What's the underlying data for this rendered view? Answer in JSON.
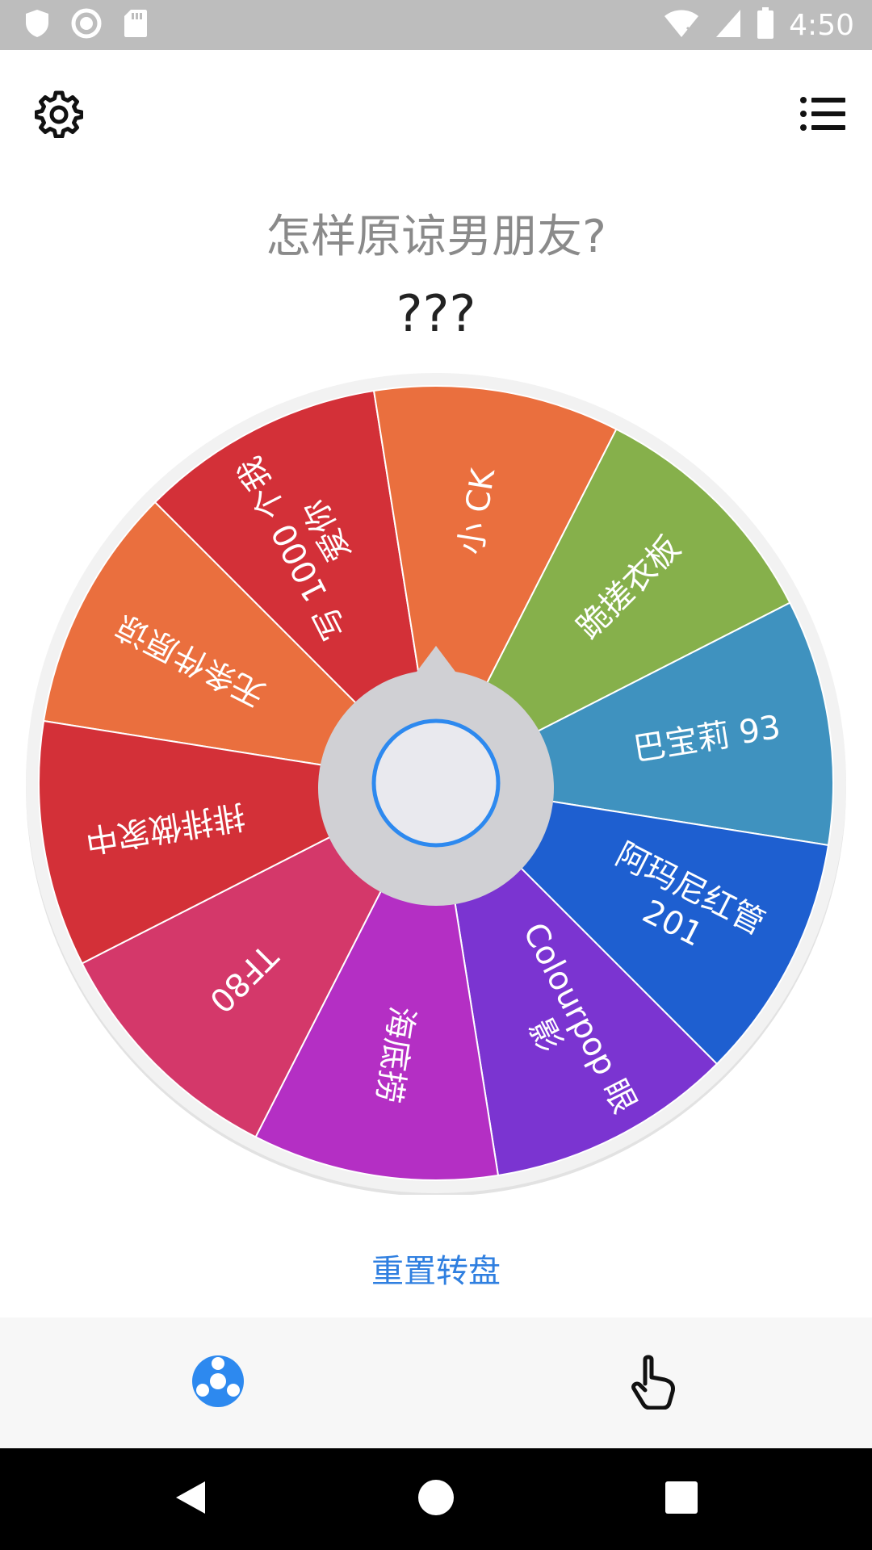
{
  "status_bar": {
    "time": "4:50",
    "left_icons": [
      "shield-icon",
      "record-icon",
      "sd-card-icon"
    ],
    "right_icons": [
      "wifi-off-icon",
      "signal-icon",
      "battery-icon"
    ]
  },
  "header": {
    "settings_icon": "gear-icon",
    "list_icon": "list-menu-icon"
  },
  "title": "怎样原谅男朋友?",
  "result": "???",
  "wheel": {
    "pointer_color": "#d0d0d4",
    "center_ring_color": "#2d89ef",
    "segments": [
      {
        "label": [
          "无条件原谅"
        ],
        "color": "#ea6f3e"
      },
      {
        "label": [
          "写 1000 个我",
          "爱你"
        ],
        "color": "#d33038"
      },
      {
        "label": [
          "小 CK"
        ],
        "color": "#ea6f3e"
      },
      {
        "label": [
          "跪搓衣板"
        ],
        "color": "#86b04b"
      },
      {
        "label": [
          "巴宝莉 93"
        ],
        "color": "#3f92bf"
      },
      {
        "label": [
          "阿玛尼红管",
          "201"
        ],
        "color": "#1e5fd0"
      },
      {
        "label": [
          "Colourpop 眼",
          "影"
        ],
        "color": "#7b34d1"
      },
      {
        "label": [
          "海底捞"
        ],
        "color": "#b42fc4"
      },
      {
        "label": [
          "TF80"
        ],
        "color": "#d4386a"
      },
      {
        "label": [
          "排排做家中"
        ],
        "color": "#d33038"
      }
    ]
  },
  "reset_label": "重置转盘",
  "bottom_tabs": [
    {
      "icon": "wheel-icon",
      "active": true,
      "color": "#2d89ef"
    },
    {
      "icon": "tap-hand-icon",
      "active": false,
      "color": "#111111"
    }
  ],
  "nav": [
    "back-icon",
    "home-icon",
    "recents-icon"
  ]
}
